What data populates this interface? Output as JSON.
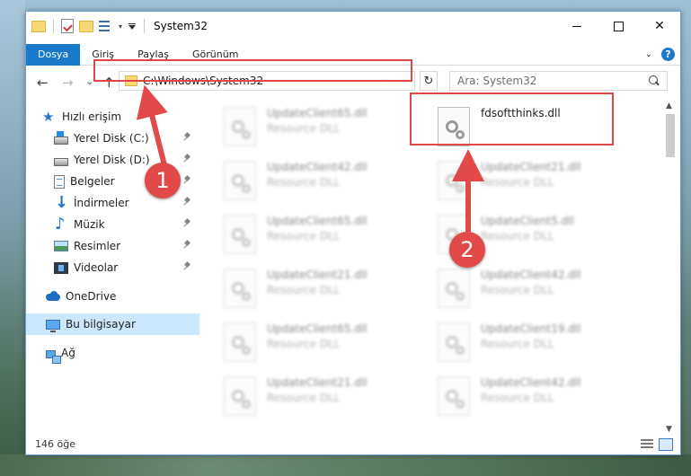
{
  "window": {
    "title": "System32"
  },
  "ribbon": {
    "tabs": [
      "Dosya",
      "Giriş",
      "Paylaş",
      "Görünüm"
    ],
    "help_label": "?"
  },
  "nav": {
    "back": "←",
    "forward": "→",
    "recent": "⌄",
    "up": "↑",
    "refresh": "↻"
  },
  "address": {
    "path": "C:\\Windows\\System32"
  },
  "search": {
    "placeholder": "Ara: System32"
  },
  "sidebar": {
    "quick_access": "Hızlı erişim",
    "items": [
      {
        "label": "Yerel Disk (C:)",
        "icon": "disk-c-icon"
      },
      {
        "label": "Yerel Disk (D:)",
        "icon": "disk-d-icon"
      },
      {
        "label": "Belgeler",
        "icon": "documents-icon"
      },
      {
        "label": "İndirmeler",
        "icon": "downloads-icon"
      },
      {
        "label": "Müzik",
        "icon": "music-icon"
      },
      {
        "label": "Resimler",
        "icon": "pictures-icon"
      },
      {
        "label": "Videolar",
        "icon": "videos-icon"
      }
    ],
    "onedrive": "OneDrive",
    "this_pc": "Bu bilgisayar",
    "network": "Ağ"
  },
  "files": [
    {
      "name": "UpdateClient65.dll",
      "type": "Resource DLL"
    },
    {
      "name": "fdsoftthinks.dll",
      "type": ""
    },
    {
      "name": "UpdateClient42.dll",
      "type": "Resource DLL"
    },
    {
      "name": "UpdateClient21.dll",
      "type": "Resource DLL"
    },
    {
      "name": "UpdateClient65.dll",
      "type": "Resource DLL"
    },
    {
      "name": "UpdateClient5.dll",
      "type": "Resource DLL"
    },
    {
      "name": "UpdateClient21.dll",
      "type": "Resource DLL"
    },
    {
      "name": "UpdateClient42.dll",
      "type": "Resource DLL"
    },
    {
      "name": "UpdateClient65.dll",
      "type": "Resource DLL"
    },
    {
      "name": "UpdateClient19.dll",
      "type": "Resource DLL"
    },
    {
      "name": "UpdateClient21.dll",
      "type": "Resource DLL"
    },
    {
      "name": "UpdateClient42.dll",
      "type": "Resource DLL"
    }
  ],
  "status": {
    "item_count": "146 öğe"
  },
  "annotations": {
    "marker1": "1",
    "marker2": "2",
    "color": "#e24a4a"
  }
}
